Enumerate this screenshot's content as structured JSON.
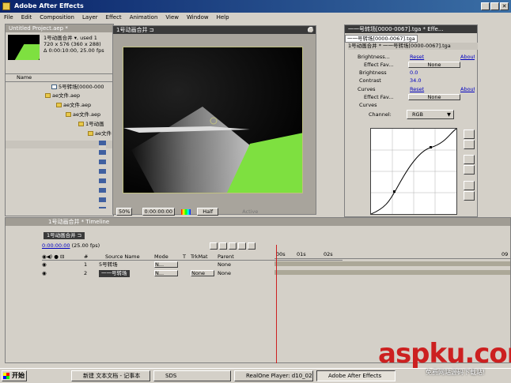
{
  "app": {
    "title": "Adobe After Effects"
  },
  "menu": [
    "File",
    "Edit",
    "Composition",
    "Layer",
    "Effect",
    "Animation",
    "View",
    "Window",
    "Help"
  ],
  "project": {
    "title": "Untitled Project.aep *",
    "comp_name": "1号动画合并 ▾, used 1",
    "info1": "720 x 576  (360 x 288)",
    "info2": "Δ 0:00:10:00, 25.00 fps",
    "col_name": "Name",
    "items": [
      "5号转场[0000-000",
      "ae文件.aep",
      "ae文件.aep",
      "ae文件.aep",
      "1号动画",
      "ae文件"
    ]
  },
  "comp_window": {
    "title": "1号动画合并 ⊐",
    "zoom": "50%",
    "timecode": "0:00:00:00",
    "resolution": "Half",
    "active": "Active"
  },
  "effects": {
    "title": "一一号转场[0000-0067].tga * Effe...",
    "tab1": "一一号转场[0000-0067].tga",
    "tab2": "1号动画合并 * 一一号转场[0000-0067].tga",
    "brightness_label": "Brightness...",
    "reset": "Reset",
    "about": "About...",
    "effect_fav": "Effect Fav...",
    "none": "None",
    "brightness_param": "Brightness",
    "brightness_value": "0.0",
    "contrast_param": "Contrast",
    "contrast_value": "34.0",
    "curves_label": "Curves",
    "curves_param": "Curves",
    "channel_label": "Channel:",
    "channel_value": "RGB"
  },
  "timeline": {
    "title": "1号动画合并 * Timeline",
    "tab": "1号动画合并 ⊐",
    "timecode": "0:00:00:00",
    "fps": "(25.00 fps)",
    "columns": [
      "#",
      "Source Name",
      "Mode",
      "T",
      "TrkMat",
      "Parent"
    ],
    "ruler": [
      "00s",
      "01s",
      "02s",
      "09"
    ],
    "layers": [
      {
        "num": "1",
        "name": "5号转场",
        "mode": "N...",
        "trkmat": "",
        "parent": "None"
      },
      {
        "num": "2",
        "name": "一一号转场",
        "mode": "N...",
        "trkmat": "None",
        "parent": "None"
      }
    ]
  },
  "taskbar": {
    "start": "开始",
    "tasks": [
      "新建 文本文档 - 记事本",
      "SDS",
      "RealOne Player: d10_02...",
      "Adobe After Effects"
    ]
  },
  "watermark": {
    "main": "aspku.com",
    "sub": "免费网站源码下载站!"
  },
  "colors": {
    "accent": "#0a246a",
    "green": "#7ee040",
    "red": "#cc2020"
  }
}
